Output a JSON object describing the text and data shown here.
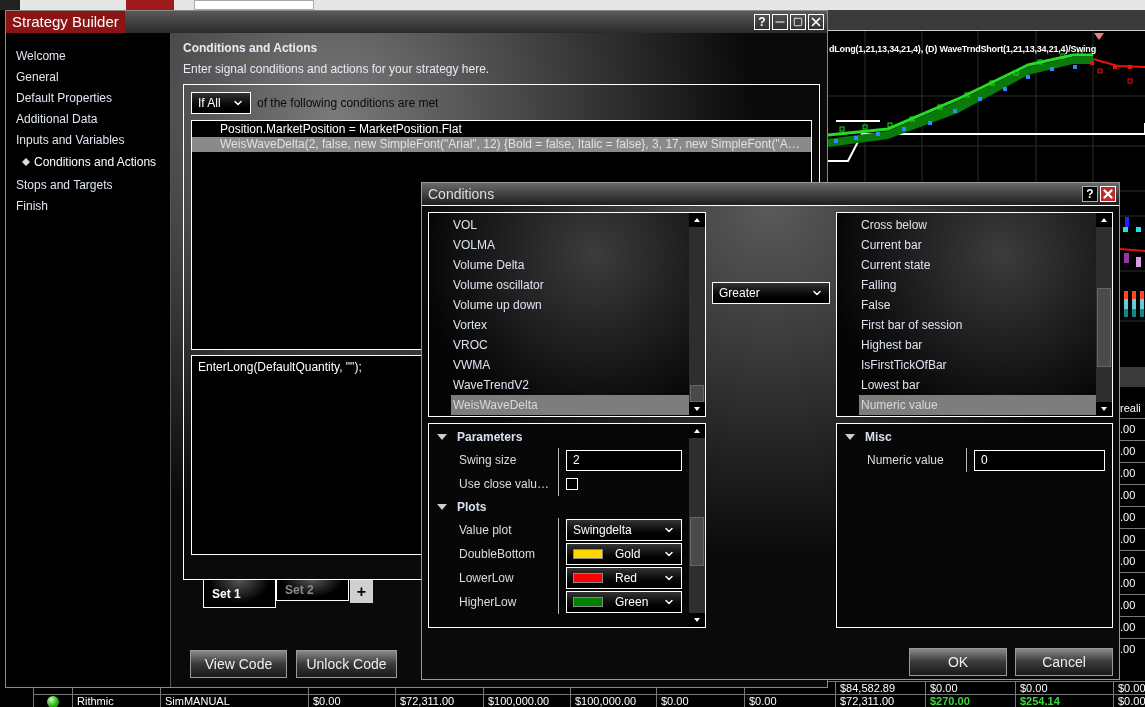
{
  "background_app": {
    "chart_title": "dLong(1,21,13,34,21,4), (D) WaveTrndShort(1,21,13,34,21,4)/Swing",
    "column_header": "reali",
    "column_cells": [
      ".00",
      ".00",
      ".00",
      ".00",
      ".00",
      ".00",
      ".00",
      ".00",
      ".00",
      ".00",
      ".00"
    ],
    "rows": [
      {
        "cells": [
          {
            "text": ""
          },
          {
            "text": ""
          },
          {
            "text": ""
          },
          {
            "text": ""
          },
          {
            "text": ""
          },
          {
            "text": ""
          },
          {
            "text": ""
          },
          {
            "text": ""
          },
          {
            "text": "$84,582.89",
            "positive": false
          },
          {
            "text": "$0.00",
            "positive": false
          },
          {
            "text": "$0.00",
            "positive": false
          },
          {
            "text": "$0.00",
            "positive": false
          }
        ]
      },
      {
        "connected": true,
        "cells": [
          {
            "text": "Rithmic",
            "positive": false
          },
          {
            "text": "SimMANUAL",
            "positive": false
          },
          {
            "text": "$0.00",
            "positive": false
          },
          {
            "text": "$72,311.00",
            "positive": false
          },
          {
            "text": "$100,000.00",
            "positive": false
          },
          {
            "text": "$100,000.00",
            "positive": false
          },
          {
            "text": "$0.00",
            "positive": false
          },
          {
            "text": "$0.00",
            "positive": false
          },
          {
            "text": "$72,311.00",
            "positive": false
          },
          {
            "text": "$270.00",
            "positive": true
          },
          {
            "text": "$254.14",
            "positive": true
          },
          {
            "text": "$0.00",
            "positive": false
          }
        ]
      }
    ]
  },
  "strategy_builder": {
    "title": "Strategy Builder",
    "help": "?",
    "sidebar": [
      {
        "label": "Welcome",
        "selected": false
      },
      {
        "label": "General",
        "selected": false
      },
      {
        "label": "Default Properties",
        "selected": false
      },
      {
        "label": "Additional Data",
        "selected": false
      },
      {
        "label": "Inputs and Variables",
        "selected": false
      },
      {
        "label": "Conditions and Actions",
        "selected": true
      },
      {
        "label": "Stops and Targets",
        "selected": false
      },
      {
        "label": "Finish",
        "selected": false
      }
    ],
    "heading": "Conditions and Actions",
    "description": "Enter signal conditions and actions for your strategy here.",
    "conditions": {
      "mode": "If All",
      "mode_suffix": "of the following conditions are met",
      "items": [
        {
          "text": "Position.MarketPosition = MarketPosition.Flat",
          "selected": false
        },
        {
          "text": "WeisWaveDelta(2, false, new SimpleFont(\"Arial\", 12) {Bold = false, Italic = false}, 3, 17, new SimpleFont(\"A…",
          "selected": true
        }
      ]
    },
    "actions": [
      "EnterLong(DefaultQuantity, \"\");"
    ],
    "sets": [
      {
        "label": "Set 1",
        "selected": true
      },
      {
        "label": "Set 2",
        "selected": false
      }
    ],
    "add_set": "+",
    "buttons": [
      "View Code",
      "Unlock Code"
    ]
  },
  "conditions_dialog": {
    "title": "Conditions",
    "help": "?",
    "left_list": [
      {
        "label": "VOL",
        "selected": false
      },
      {
        "label": "VOLMA",
        "selected": false
      },
      {
        "label": "Volume Delta",
        "selected": false
      },
      {
        "label": "Volume oscillator",
        "selected": false
      },
      {
        "label": "Volume up down",
        "selected": false
      },
      {
        "label": "Vortex",
        "selected": false
      },
      {
        "label": "VROC",
        "selected": false
      },
      {
        "label": "VWMA",
        "selected": false
      },
      {
        "label": "WaveTrendV2",
        "selected": false
      },
      {
        "label": "WeisWaveDelta",
        "selected": true
      }
    ],
    "operator": "Greater",
    "right_list": [
      {
        "label": "Cross below",
        "selected": false
      },
      {
        "label": "Current bar",
        "selected": false
      },
      {
        "label": "Current state",
        "selected": false
      },
      {
        "label": "Falling",
        "selected": false
      },
      {
        "label": "False",
        "selected": false
      },
      {
        "label": "First bar of session",
        "selected": false
      },
      {
        "label": "Highest bar",
        "selected": false
      },
      {
        "label": "IsFirstTickOfBar",
        "selected": false
      },
      {
        "label": "Lowest bar",
        "selected": false
      },
      {
        "label": "Numeric value",
        "selected": true
      }
    ],
    "left_properties": [
      {
        "group": "Parameters",
        "rows": [
          {
            "kind": "text",
            "label": "Swing size",
            "value": "2"
          },
          {
            "kind": "checkbox",
            "label": "Use close valu…",
            "checked": false
          }
        ]
      },
      {
        "group": "Plots",
        "rows": [
          {
            "kind": "select",
            "label": "Value plot",
            "value": "Swingdelta"
          },
          {
            "kind": "color",
            "label": "DoubleBottom",
            "value": "Gold",
            "color": "#ffd700"
          },
          {
            "kind": "color",
            "label": "LowerLow",
            "value": "Red",
            "color": "#ff0000"
          },
          {
            "kind": "color",
            "label": "HigherLow",
            "value": "Green",
            "color": "#008000"
          }
        ]
      }
    ],
    "right_properties": [
      {
        "group": "Misc",
        "rows": [
          {
            "kind": "text",
            "label": "Numeric value",
            "value": "0"
          }
        ]
      }
    ],
    "buttons": [
      "OK",
      "Cancel"
    ]
  }
}
